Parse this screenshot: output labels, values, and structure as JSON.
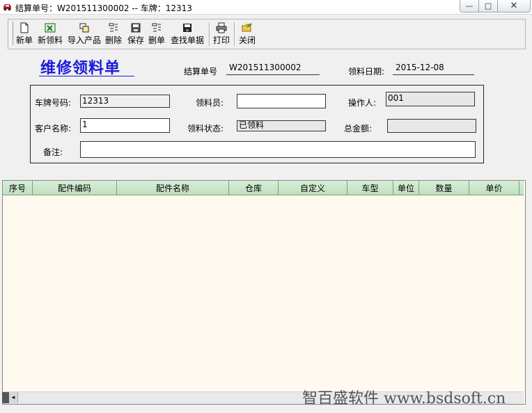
{
  "window": {
    "title": "结算单号：W201511300002 -- 车牌：12313",
    "min_glyph": "—",
    "max_glyph": "□",
    "close_glyph": "✕"
  },
  "toolbar": {
    "new_order": "新单",
    "new_pick": "新领料",
    "import_product": "导入产品",
    "delete": "删除",
    "save": "保存",
    "delete_order": "删单",
    "find_order": "查找单据",
    "print": "打印",
    "close": "关闭"
  },
  "header": {
    "title": "维修领料单",
    "settle_no_label": "结算单号",
    "settle_no_value": "W201511300002",
    "pick_date_label": "领料日期:",
    "pick_date_value": "2015-12-08"
  },
  "form": {
    "plate_label": "车牌号码:",
    "plate_value": "12313",
    "picker_label": "领料员:",
    "picker_value": "",
    "operator_label": "操作人:",
    "operator_value": "001",
    "customer_label": "客户名称:",
    "customer_value": "1",
    "status_label": "领料状态:",
    "status_value": "已领料",
    "total_label": "总金额:",
    "total_value": "",
    "remark_label": "备注:",
    "remark_value": ""
  },
  "grid": {
    "columns": [
      "序号",
      "配件编码",
      "配件名称",
      "仓库",
      "自定义",
      "车型",
      "单位",
      "数量",
      "单价"
    ]
  },
  "scrollbar": {
    "left_glyph": "◂"
  },
  "watermark": "智百盛软件 www.bsdsoft.cn",
  "colors": {
    "title_blue": "#1a1adc",
    "grid_header": "#c8e6c8",
    "grid_body": "#fffaef"
  }
}
